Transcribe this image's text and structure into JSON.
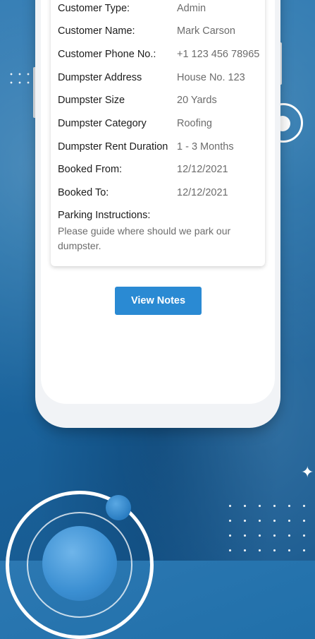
{
  "details": {
    "rows": [
      {
        "label": "Customer Type:",
        "value": "Admin"
      },
      {
        "label": "Customer Name:",
        "value": "Mark Carson"
      },
      {
        "label": "Customer Phone No.:",
        "value": "+1 123 456 78965"
      },
      {
        "label": "Dumpster Address",
        "value": "House No. 123"
      },
      {
        "label": "Dumpster Size",
        "value": "20 Yards"
      },
      {
        "label": "Dumpster Category",
        "value": "Roofing"
      },
      {
        "label": "Dumpster Rent Duration",
        "value": "1 - 3 Months"
      },
      {
        "label": "Booked From:",
        "value": "12/12/2021"
      },
      {
        "label": "Booked To:",
        "value": "12/12/2021"
      }
    ],
    "parking_label": "Parking Instructions:",
    "parking_text": "Please guide where should we park our dumpster."
  },
  "actions": {
    "view_notes_label": "View Notes"
  },
  "colors": {
    "background": "#1e6ea8",
    "button": "#2a8ad3",
    "label_text": "#1c1c1c",
    "value_text": "#6c6c6c"
  }
}
